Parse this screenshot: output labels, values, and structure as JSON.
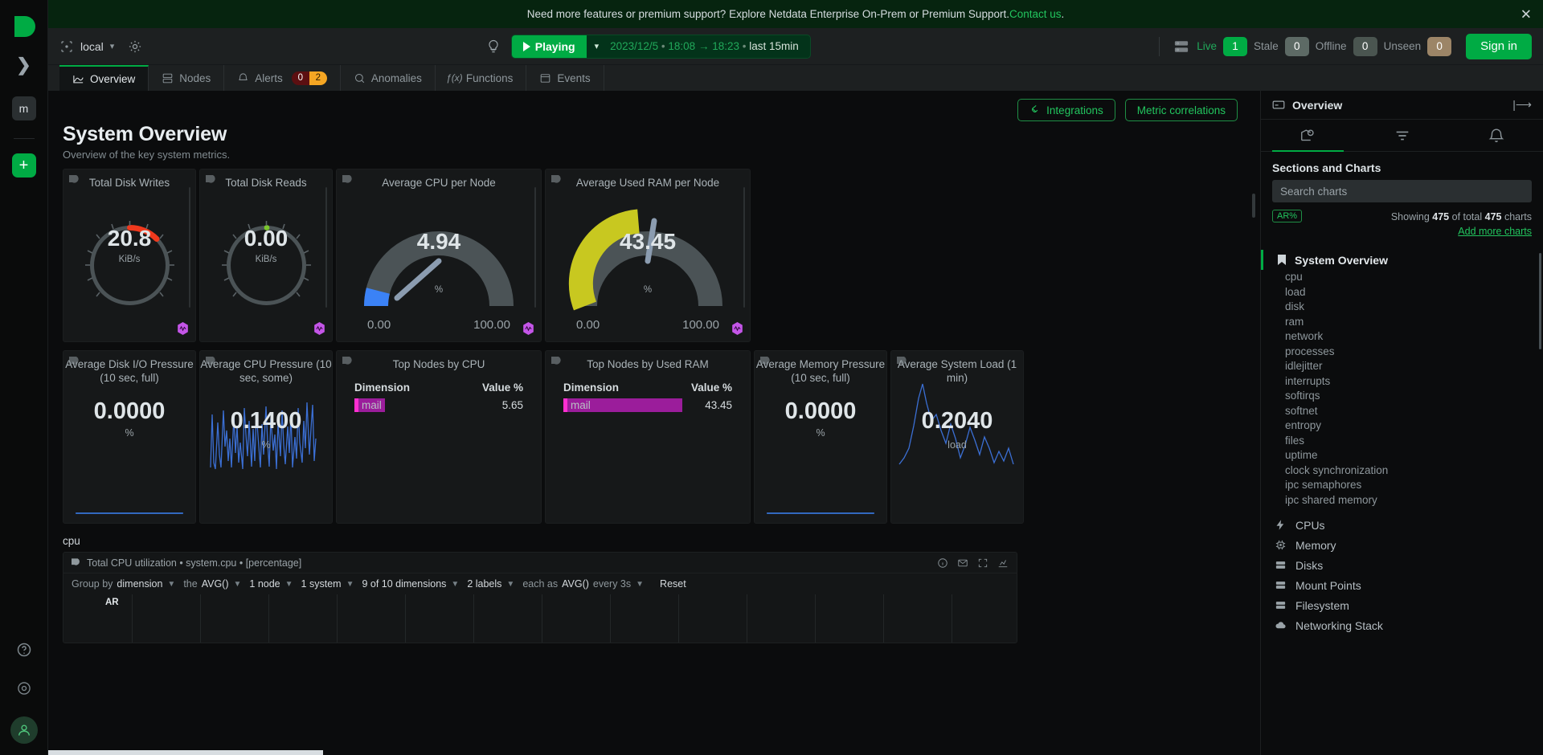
{
  "banner": {
    "text": "Need more features or premium support? Explore Netdata Enterprise On-Prem or Premium Support. ",
    "link": "Contact us",
    "period": ".",
    "close_icon": "close-icon"
  },
  "toolbar": {
    "node_name": "local",
    "node_icon": "node-target-icon",
    "caret_icon": "chevron-down-icon",
    "gear_icon": "gear-icon",
    "bulb_icon": "lightbulb-icon",
    "play_label": "Playing",
    "play_icon": "play-icon",
    "time_date": "2023/12/5",
    "time_start": "18:08",
    "time_arrow": "→",
    "time_end": "18:23",
    "time_last_label": "last",
    "time_last_value": "15min",
    "nodes_icon": "servers-icon",
    "status": [
      {
        "label": "Live",
        "count": "1",
        "style": "green"
      },
      {
        "label": "Stale",
        "count": "0",
        "style": "gray"
      },
      {
        "label": "Offline",
        "count": "0",
        "style": "dark"
      },
      {
        "label": "Unseen",
        "count": "0",
        "style": "tan"
      }
    ],
    "signin": "Sign in"
  },
  "tabs": [
    {
      "label": "Overview",
      "icon": "overview-icon",
      "active": true
    },
    {
      "label": "Nodes",
      "icon": "nodes-icon",
      "active": false
    },
    {
      "label": "Alerts",
      "icon": "bell-icon",
      "active": false,
      "badges": [
        "0",
        "2"
      ]
    },
    {
      "label": "Anomalies",
      "icon": "anomaly-search-icon",
      "active": false
    },
    {
      "label": "Functions",
      "icon": "function-icon",
      "active": false
    },
    {
      "label": "Events",
      "icon": "events-icon",
      "active": false
    }
  ],
  "dashboard": {
    "actions": [
      {
        "label": "Integrations",
        "icon": "integrations-icon"
      },
      {
        "label": "Metric correlations",
        "icon": ""
      }
    ],
    "section_title": "System Overview",
    "section_sub": "Overview of the key system metrics.",
    "row1": [
      {
        "title": "Total Disk Writes",
        "type": "dial",
        "value": "20.8",
        "unit": "KiB/s",
        "arc_color": "#f0391d",
        "arc_pct": 0.12,
        "arc_start": 0.42
      },
      {
        "title": "Total Disk Reads",
        "type": "dial",
        "value": "0.00",
        "unit": "KiB/s",
        "arc_color": "#7bc62d",
        "arc_pct": 0.01,
        "arc_start": 0.5
      },
      {
        "title": "Average CPU per Node",
        "type": "gauge",
        "value": "4.94",
        "unit": "%",
        "min": "0.00",
        "max": "100.00",
        "needle_color": "#3b82f6",
        "fill_pct": 0.0494
      },
      {
        "title": "Average Used RAM per Node",
        "type": "gauge",
        "value": "43.45",
        "unit": "%",
        "min": "0.00",
        "max": "100.00",
        "needle_color": "#c8c820",
        "fill_pct": 0.4345
      }
    ],
    "row2": [
      {
        "title": "Average Disk I/O Pressure (10 sec, full)",
        "type": "number",
        "value": "0.0000",
        "unit": "%",
        "spark": "flat"
      },
      {
        "title": "Average CPU Pressure (10 sec, some)",
        "type": "number",
        "value": "0.1400",
        "unit": "%",
        "spark": "noisy"
      },
      {
        "title": "Top Nodes by CPU",
        "type": "table",
        "col1": "Dimension",
        "col2": "Value %",
        "rows": [
          {
            "name": "mail",
            "value": "5.65",
            "bar_pct": 0.16
          }
        ]
      },
      {
        "title": "Top Nodes by Used RAM",
        "type": "table",
        "col1": "Dimension",
        "col2": "Value %",
        "rows": [
          {
            "name": "mail",
            "value": "43.45",
            "bar_pct": 0.8
          }
        ]
      },
      {
        "title": "Average Memory Pressure (10 sec, full)",
        "type": "number",
        "value": "0.0000",
        "unit": "%",
        "spark": "flat"
      },
      {
        "title": "Average System Load (1 min)",
        "type": "number",
        "value": "0.2040",
        "unit": "load",
        "spark": "wave"
      }
    ],
    "cpu_label": "cpu",
    "chart": {
      "title": "Total CPU utilization • system.cpu • [percentage]",
      "flag_icon": "netdata-flag-icon",
      "actions": [
        "info-icon",
        "mail-icon",
        "fullscreen-icon",
        "chart-icon"
      ],
      "controls": [
        {
          "pre": "Group by",
          "val": "dimension",
          "caret": true
        },
        {
          "pre": "the",
          "val": "AVG()",
          "caret": true
        },
        {
          "pre": "",
          "val": "1 node",
          "caret": true
        },
        {
          "pre": "",
          "val": "1 system",
          "caret": true
        },
        {
          "pre": "",
          "val": "9 of 10 dimensions",
          "caret": true
        },
        {
          "pre": "",
          "val": "2 labels",
          "caret": true
        },
        {
          "pre": "each as",
          "val": "AVG()",
          "caret": false
        },
        {
          "pre": "every 3s",
          "val": "",
          "caret": true
        }
      ],
      "reset": "Reset",
      "ar_label": "AR"
    }
  },
  "right_panel": {
    "header": "Overview",
    "header_icon": "panel-icon",
    "collapse_icon": "collapse-right-icon",
    "tabs": [
      {
        "icon": "charts-tree-icon",
        "active": true
      },
      {
        "icon": "filter-icon",
        "active": false
      },
      {
        "icon": "bell-icon",
        "active": false
      }
    ],
    "section_label": "Sections and Charts",
    "search_placeholder": "Search charts",
    "ar_badge": "AR%",
    "showing_pre": "Showing ",
    "showing_count": "475",
    "showing_mid": " of total ",
    "showing_total": "475",
    "showing_post": " charts",
    "add_more": "Add more charts",
    "group": {
      "label": "System Overview",
      "icon": "bookmark-icon"
    },
    "items": [
      "cpu",
      "load",
      "disk",
      "ram",
      "network",
      "processes",
      "idlejitter",
      "interrupts",
      "softirqs",
      "softnet",
      "entropy",
      "files",
      "uptime",
      "clock synchronization",
      "ipc semaphores",
      "ipc shared memory"
    ],
    "categories": [
      {
        "label": "CPUs",
        "icon": "bolt-icon"
      },
      {
        "label": "Memory",
        "icon": "chip-icon"
      },
      {
        "label": "Disks",
        "icon": "disk-icon"
      },
      {
        "label": "Mount Points",
        "icon": "disk-icon"
      },
      {
        "label": "Filesystem",
        "icon": "disk-icon"
      },
      {
        "label": "Networking Stack",
        "icon": "cloud-icon"
      }
    ]
  },
  "rail": {
    "logo_icon": "netdata-logo-icon",
    "expand_icon": "chevron-right-icon",
    "space_initial": "m",
    "add_icon": "plus-icon",
    "help_icon": "help-icon",
    "settings_icon": "settings-icon",
    "user_icon": "user-avatar-icon"
  },
  "colors": {
    "accent": "#00ab44",
    "link": "#22c55e",
    "magenta": "#9b1d9b",
    "blue": "#3b82f6",
    "yellow": "#c8c820",
    "red": "#f0391d"
  }
}
